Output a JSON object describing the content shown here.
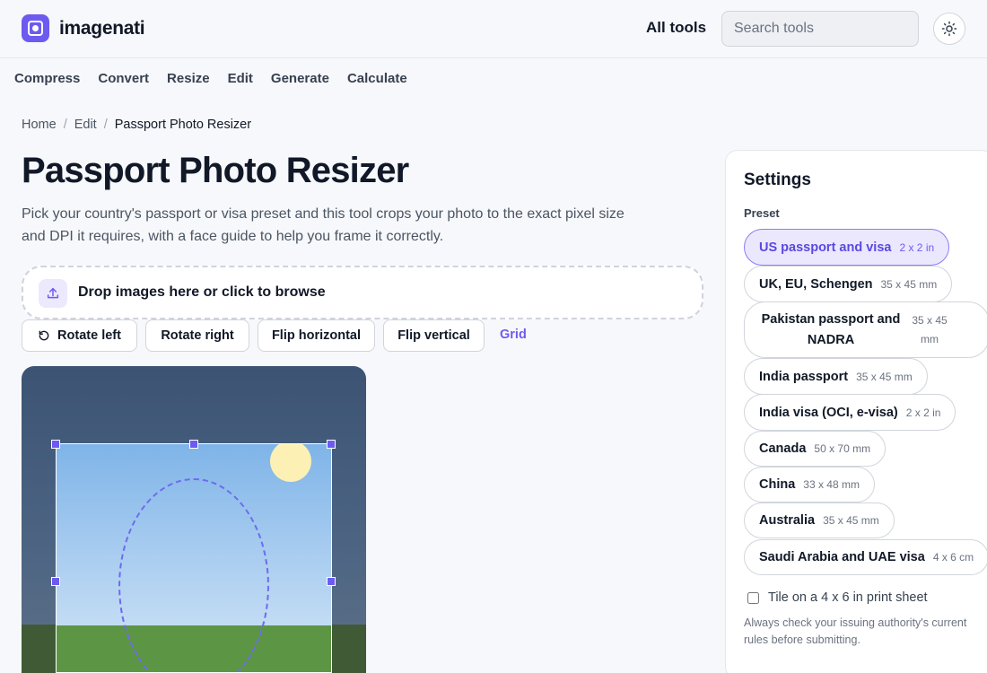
{
  "header": {
    "brand": "imagenati",
    "all_tools": "All tools",
    "search_placeholder": "Search tools"
  },
  "nav": [
    "Compress",
    "Convert",
    "Resize",
    "Edit",
    "Generate",
    "Calculate"
  ],
  "breadcrumb": {
    "home": "Home",
    "section": "Edit",
    "current": "Passport Photo Resizer",
    "separator": "/"
  },
  "page": {
    "title": "Passport Photo Resizer",
    "description": "Pick your country's passport or visa preset and this tool crops your photo to the exact pixel size and DPI it requires, with a face guide to help you frame it correctly."
  },
  "dropzone": {
    "label": "Drop images here or click to browse"
  },
  "toolbar": {
    "rotate_left": "Rotate left",
    "rotate_right": "Rotate right",
    "flip_horizontal": "Flip horizontal",
    "flip_vertical": "Flip vertical",
    "grid": "Grid"
  },
  "settings": {
    "title": "Settings",
    "preset_label": "Preset",
    "presets": [
      {
        "name": "US passport and visa",
        "size": "2 x 2 in",
        "selected": true
      },
      {
        "name": "UK, EU, Schengen",
        "size": "35 x 45 mm"
      },
      {
        "name": "Pakistan passport and NADRA",
        "size": "35 x 45 mm"
      },
      {
        "name": "India passport",
        "size": "35 x 45 mm"
      },
      {
        "name": "India visa (OCI, e-visa)",
        "size": "2 x 2 in"
      },
      {
        "name": "Canada",
        "size": "50 x 70 mm"
      },
      {
        "name": "China",
        "size": "33 x 48 mm"
      },
      {
        "name": "Australia",
        "size": "35 x 45 mm"
      },
      {
        "name": "Saudi Arabia and UAE visa",
        "size": "4 x 6 cm"
      }
    ],
    "tile_label": "Tile on a 4 x 6 in print sheet",
    "tile_checked": false,
    "note": "Always check your issuing authority's current rules before submitting."
  },
  "colors": {
    "accent": "#6d5bf0",
    "accent_light": "#ebe8fd",
    "page_bg": "#f7f8fb"
  }
}
